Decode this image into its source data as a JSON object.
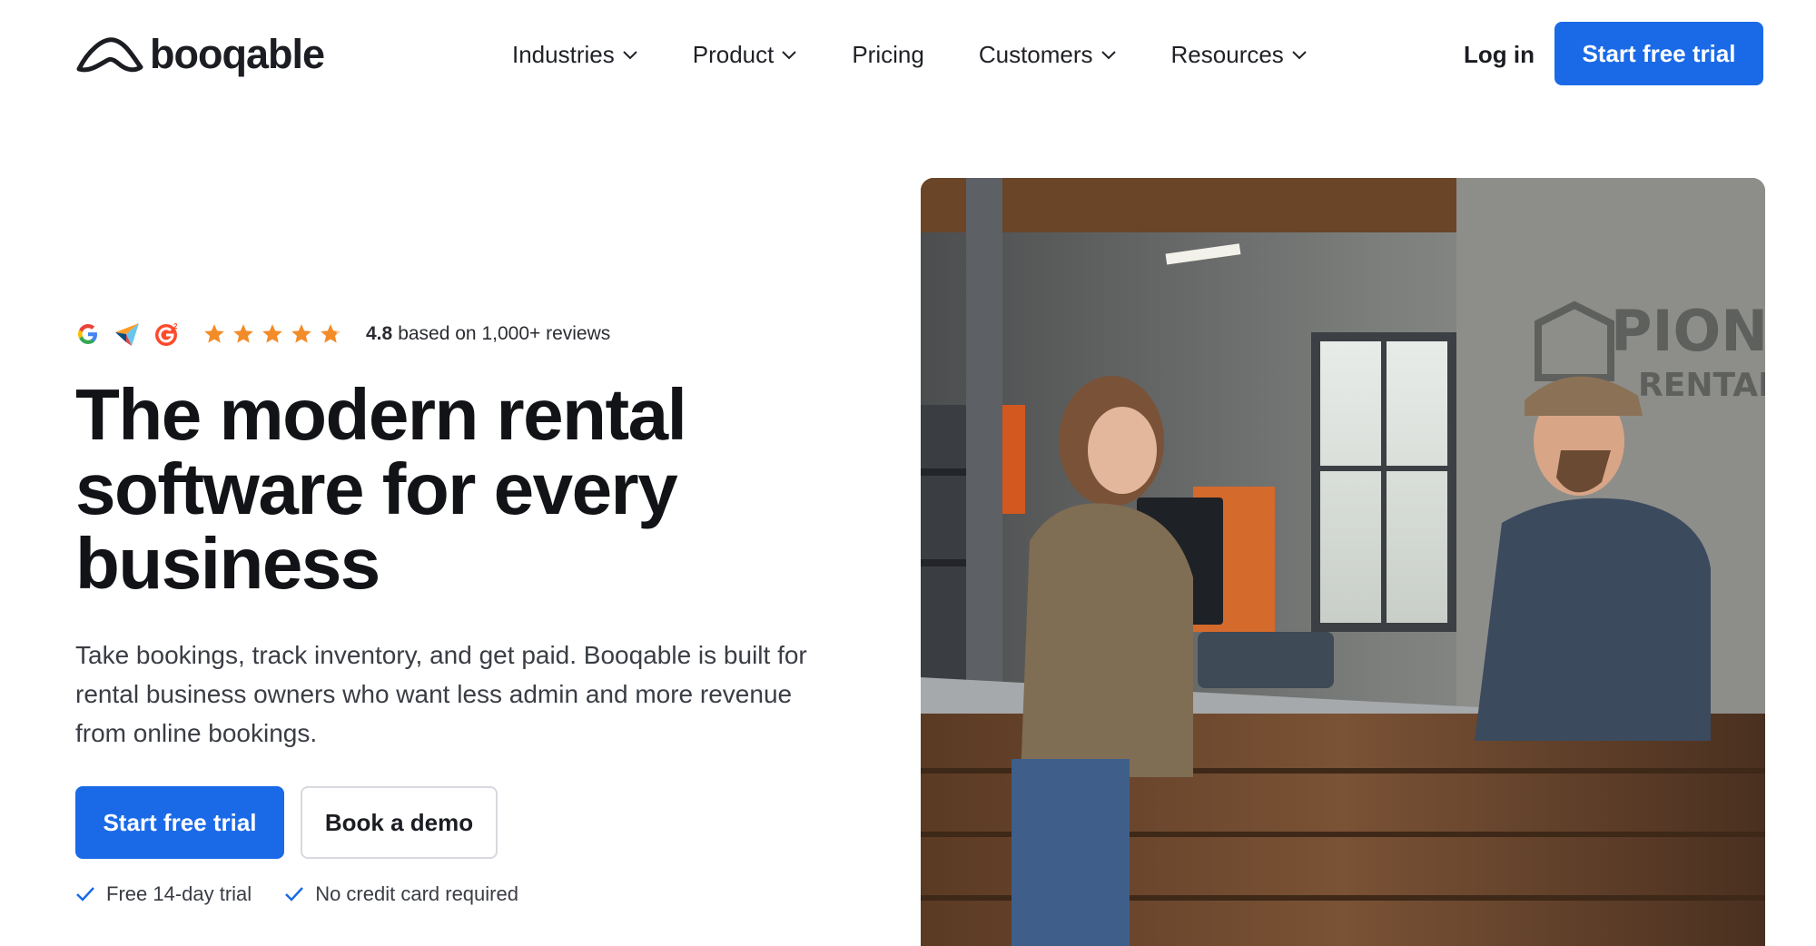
{
  "header": {
    "logo_text": "booqable",
    "nav": [
      {
        "label": "Industries",
        "dropdown": true
      },
      {
        "label": "Product",
        "dropdown": true
      },
      {
        "label": "Pricing",
        "dropdown": false
      },
      {
        "label": "Customers",
        "dropdown": true
      },
      {
        "label": "Resources",
        "dropdown": true
      }
    ],
    "login_label": "Log in",
    "cta_label": "Start free trial"
  },
  "hero": {
    "rating": {
      "icons": [
        "google-icon",
        "capterra-icon",
        "g2-icon"
      ],
      "stars": 4.8,
      "score": "4.8",
      "text": "based on 1,000+ reviews"
    },
    "headline": [
      "The modern rental",
      "software for every",
      "business"
    ],
    "subtext": [
      "Take bookings, track inventory, and get paid. Booqable is built for",
      "rental business owners who want less admin and more revenue",
      "from online bookings."
    ],
    "primary_button": "Start free trial",
    "secondary_button": "Book a demo",
    "checks": [
      "Free 14-day trial",
      "No credit card required"
    ],
    "image": {
      "sign_line1": "PIONEE",
      "sign_line2": "RENTALS"
    }
  },
  "colors": {
    "accent": "#1a6ae8",
    "star": "#f28c28",
    "text": "#16181d"
  }
}
